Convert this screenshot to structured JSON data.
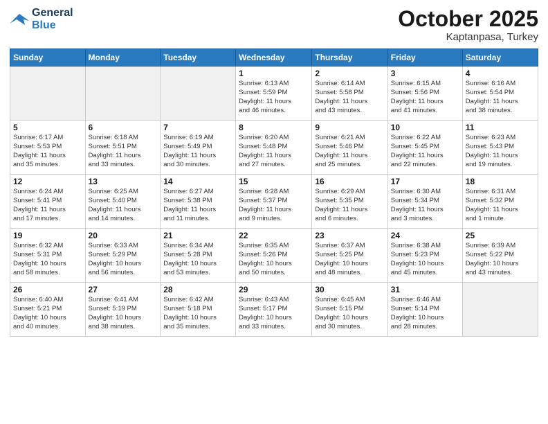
{
  "header": {
    "logo_line1": "General",
    "logo_line2": "Blue",
    "month": "October 2025",
    "location": "Kaptanpasa, Turkey"
  },
  "days_of_week": [
    "Sunday",
    "Monday",
    "Tuesday",
    "Wednesday",
    "Thursday",
    "Friday",
    "Saturday"
  ],
  "weeks": [
    [
      {
        "day": "",
        "info": "",
        "empty": true
      },
      {
        "day": "",
        "info": "",
        "empty": true
      },
      {
        "day": "",
        "info": "",
        "empty": true
      },
      {
        "day": "1",
        "info": "Sunrise: 6:13 AM\nSunset: 5:59 PM\nDaylight: 11 hours\nand 46 minutes."
      },
      {
        "day": "2",
        "info": "Sunrise: 6:14 AM\nSunset: 5:58 PM\nDaylight: 11 hours\nand 43 minutes."
      },
      {
        "day": "3",
        "info": "Sunrise: 6:15 AM\nSunset: 5:56 PM\nDaylight: 11 hours\nand 41 minutes."
      },
      {
        "day": "4",
        "info": "Sunrise: 6:16 AM\nSunset: 5:54 PM\nDaylight: 11 hours\nand 38 minutes."
      }
    ],
    [
      {
        "day": "5",
        "info": "Sunrise: 6:17 AM\nSunset: 5:53 PM\nDaylight: 11 hours\nand 35 minutes."
      },
      {
        "day": "6",
        "info": "Sunrise: 6:18 AM\nSunset: 5:51 PM\nDaylight: 11 hours\nand 33 minutes."
      },
      {
        "day": "7",
        "info": "Sunrise: 6:19 AM\nSunset: 5:49 PM\nDaylight: 11 hours\nand 30 minutes."
      },
      {
        "day": "8",
        "info": "Sunrise: 6:20 AM\nSunset: 5:48 PM\nDaylight: 11 hours\nand 27 minutes."
      },
      {
        "day": "9",
        "info": "Sunrise: 6:21 AM\nSunset: 5:46 PM\nDaylight: 11 hours\nand 25 minutes."
      },
      {
        "day": "10",
        "info": "Sunrise: 6:22 AM\nSunset: 5:45 PM\nDaylight: 11 hours\nand 22 minutes."
      },
      {
        "day": "11",
        "info": "Sunrise: 6:23 AM\nSunset: 5:43 PM\nDaylight: 11 hours\nand 19 minutes."
      }
    ],
    [
      {
        "day": "12",
        "info": "Sunrise: 6:24 AM\nSunset: 5:41 PM\nDaylight: 11 hours\nand 17 minutes."
      },
      {
        "day": "13",
        "info": "Sunrise: 6:25 AM\nSunset: 5:40 PM\nDaylight: 11 hours\nand 14 minutes."
      },
      {
        "day": "14",
        "info": "Sunrise: 6:27 AM\nSunset: 5:38 PM\nDaylight: 11 hours\nand 11 minutes."
      },
      {
        "day": "15",
        "info": "Sunrise: 6:28 AM\nSunset: 5:37 PM\nDaylight: 11 hours\nand 9 minutes."
      },
      {
        "day": "16",
        "info": "Sunrise: 6:29 AM\nSunset: 5:35 PM\nDaylight: 11 hours\nand 6 minutes."
      },
      {
        "day": "17",
        "info": "Sunrise: 6:30 AM\nSunset: 5:34 PM\nDaylight: 11 hours\nand 3 minutes."
      },
      {
        "day": "18",
        "info": "Sunrise: 6:31 AM\nSunset: 5:32 PM\nDaylight: 11 hours\nand 1 minute."
      }
    ],
    [
      {
        "day": "19",
        "info": "Sunrise: 6:32 AM\nSunset: 5:31 PM\nDaylight: 10 hours\nand 58 minutes."
      },
      {
        "day": "20",
        "info": "Sunrise: 6:33 AM\nSunset: 5:29 PM\nDaylight: 10 hours\nand 56 minutes."
      },
      {
        "day": "21",
        "info": "Sunrise: 6:34 AM\nSunset: 5:28 PM\nDaylight: 10 hours\nand 53 minutes."
      },
      {
        "day": "22",
        "info": "Sunrise: 6:35 AM\nSunset: 5:26 PM\nDaylight: 10 hours\nand 50 minutes."
      },
      {
        "day": "23",
        "info": "Sunrise: 6:37 AM\nSunset: 5:25 PM\nDaylight: 10 hours\nand 48 minutes."
      },
      {
        "day": "24",
        "info": "Sunrise: 6:38 AM\nSunset: 5:23 PM\nDaylight: 10 hours\nand 45 minutes."
      },
      {
        "day": "25",
        "info": "Sunrise: 6:39 AM\nSunset: 5:22 PM\nDaylight: 10 hours\nand 43 minutes."
      }
    ],
    [
      {
        "day": "26",
        "info": "Sunrise: 6:40 AM\nSunset: 5:21 PM\nDaylight: 10 hours\nand 40 minutes."
      },
      {
        "day": "27",
        "info": "Sunrise: 6:41 AM\nSunset: 5:19 PM\nDaylight: 10 hours\nand 38 minutes."
      },
      {
        "day": "28",
        "info": "Sunrise: 6:42 AM\nSunset: 5:18 PM\nDaylight: 10 hours\nand 35 minutes."
      },
      {
        "day": "29",
        "info": "Sunrise: 6:43 AM\nSunset: 5:17 PM\nDaylight: 10 hours\nand 33 minutes."
      },
      {
        "day": "30",
        "info": "Sunrise: 6:45 AM\nSunset: 5:15 PM\nDaylight: 10 hours\nand 30 minutes."
      },
      {
        "day": "31",
        "info": "Sunrise: 6:46 AM\nSunset: 5:14 PM\nDaylight: 10 hours\nand 28 minutes."
      },
      {
        "day": "",
        "info": "",
        "empty": true
      }
    ]
  ]
}
